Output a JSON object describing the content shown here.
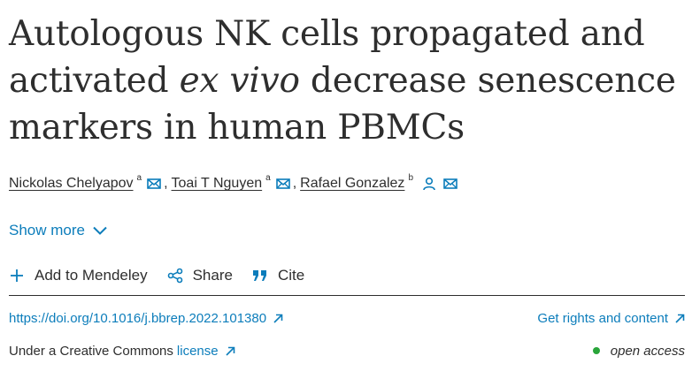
{
  "article": {
    "title_part1": "Autologous NK cells propagated and activated ",
    "title_italic": "ex vivo",
    "title_part2": " decrease senescence markers in human PBMCs"
  },
  "authors": [
    {
      "name": "Nickolas Chelyapov",
      "affiliation": "a",
      "separator": ","
    },
    {
      "name": "Toai T Nguyen",
      "affiliation": "a",
      "separator": ","
    },
    {
      "name": "Rafael Gonzalez",
      "affiliation": "b",
      "separator": ""
    }
  ],
  "show_more": {
    "label": "Show more"
  },
  "toolbar": {
    "mendeley_label": "Add to Mendeley",
    "share_label": "Share",
    "cite_label": "Cite"
  },
  "links": {
    "doi": "https://doi.org/10.1016/j.bbrep.2022.101380",
    "rights": "Get rights and content",
    "cc_prefix": "Under a Creative Commons",
    "cc_link": "license",
    "open_access": "open access"
  },
  "colors": {
    "link": "#0c7dbb",
    "text": "#2e2e2e",
    "open_access_dot": "#29a53a"
  },
  "icons": {
    "email": "envelope-icon",
    "person": "person-icon",
    "chevron": "chevron-down-icon",
    "plus": "plus-icon",
    "share": "share-icon",
    "cite": "quote-icon",
    "external": "arrow-up-right-icon"
  }
}
